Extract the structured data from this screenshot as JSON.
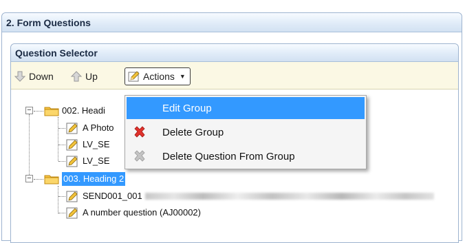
{
  "outer_panel": {
    "title": "2. Form Questions"
  },
  "inner_panel": {
    "title": "Question Selector"
  },
  "toolbar": {
    "down_label": "Down",
    "up_label": "Up",
    "actions_label": "Actions",
    "down_icon": "arrow-down-icon",
    "up_icon": "arrow-up-icon",
    "actions_icon": "pencil-icon"
  },
  "tree": {
    "groups": [
      {
        "label": "002. Headi",
        "expanded": true,
        "selected": false,
        "children": [
          "A Photo",
          "LV_SE",
          "LV_SE"
        ]
      },
      {
        "label": "003. Heading 2",
        "expanded": true,
        "selected": true,
        "children": [
          "SEND001_001",
          "A number question (AJ00002)"
        ]
      }
    ]
  },
  "actions_menu": {
    "open": true,
    "items": [
      {
        "label": "Edit Group",
        "icon": "",
        "highlighted": true,
        "enabled": true
      },
      {
        "label": "Delete Group",
        "icon": "delete-red-x-icon",
        "highlighted": false,
        "enabled": true
      },
      {
        "label": "Delete Question From Group",
        "icon": "delete-grey-x-icon",
        "highlighted": false,
        "enabled": false
      }
    ]
  },
  "colors": {
    "selection": "#3399ff",
    "toolbar_bg": "#fbf8e4",
    "header_text": "#1b2b44",
    "delete_red": "#e0322c",
    "disabled_grey": "#b5b5b5"
  }
}
